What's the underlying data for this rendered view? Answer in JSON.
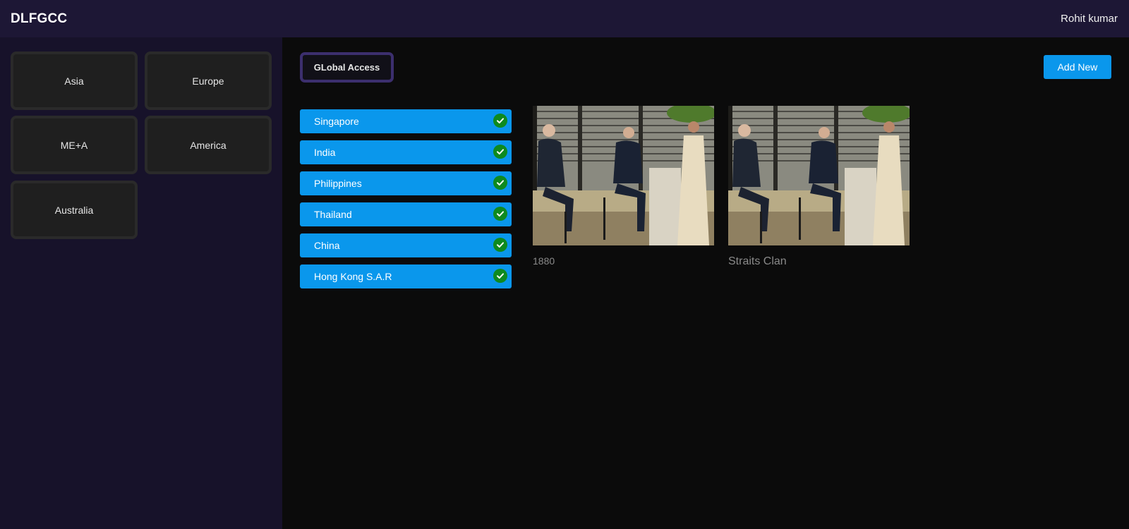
{
  "app": {
    "brand": "DLFGCC",
    "user_name": "Rohit kumar"
  },
  "sidebar": {
    "regions": [
      {
        "label": "Asia"
      },
      {
        "label": "Europe"
      },
      {
        "label": "ME+A"
      },
      {
        "label": "America"
      },
      {
        "label": "Australia"
      }
    ]
  },
  "toolbar": {
    "global_access_label": "GLobal Access",
    "add_new_label": "Add New"
  },
  "countries": [
    {
      "label": "Singapore",
      "checked": true
    },
    {
      "label": "India",
      "checked": true
    },
    {
      "label": "Philippines",
      "checked": true
    },
    {
      "label": "Thailand",
      "checked": true
    },
    {
      "label": "China",
      "checked": true
    },
    {
      "label": "Hong Kong S.A.R",
      "checked": true
    }
  ],
  "cards": [
    {
      "title": "1880"
    },
    {
      "title": "Straits Clan"
    }
  ],
  "colors": {
    "topbar": "#1d1735",
    "sidebar": "#17122a",
    "accent_blue": "#0a97ec",
    "check_green": "#0e8a1f",
    "global_border": "#3c2f6e"
  }
}
